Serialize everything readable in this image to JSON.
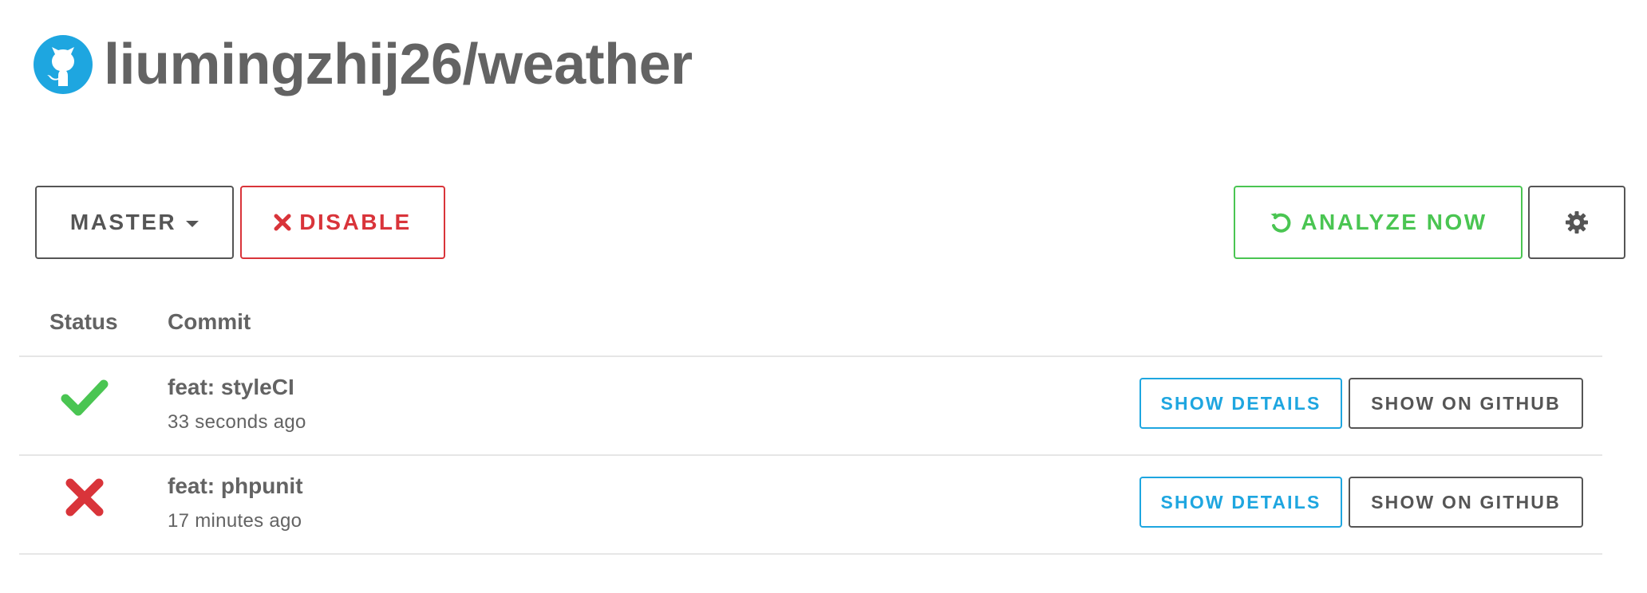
{
  "repo": {
    "title": "liumingzhij26/weather",
    "icon": "github-icon",
    "icon_color": "#1ea6e0"
  },
  "toolbar": {
    "branch_label": "MASTER",
    "disable_label": "DISABLE",
    "analyze_label": "ANALYZE NOW",
    "settings_icon": "gear-icon"
  },
  "table": {
    "headers": {
      "status": "Status",
      "commit": "Commit"
    },
    "rows": [
      {
        "status": "passed",
        "status_icon": "checkmark-icon",
        "status_color": "#4ac552",
        "message": "feat: styleCI",
        "time": "33 seconds ago",
        "details_label": "SHOW DETAILS",
        "github_label": "SHOW ON GITHUB"
      },
      {
        "status": "failed",
        "status_icon": "cross-icon",
        "status_color": "#d9343a",
        "message": "feat: phpunit",
        "time": "17 minutes ago",
        "details_label": "SHOW DETAILS",
        "github_label": "SHOW ON GITHUB"
      }
    ]
  },
  "colors": {
    "text": "#636363",
    "danger": "#d9343a",
    "success": "#4ac552",
    "info": "#1ea6e0",
    "default_border": "#555555"
  }
}
